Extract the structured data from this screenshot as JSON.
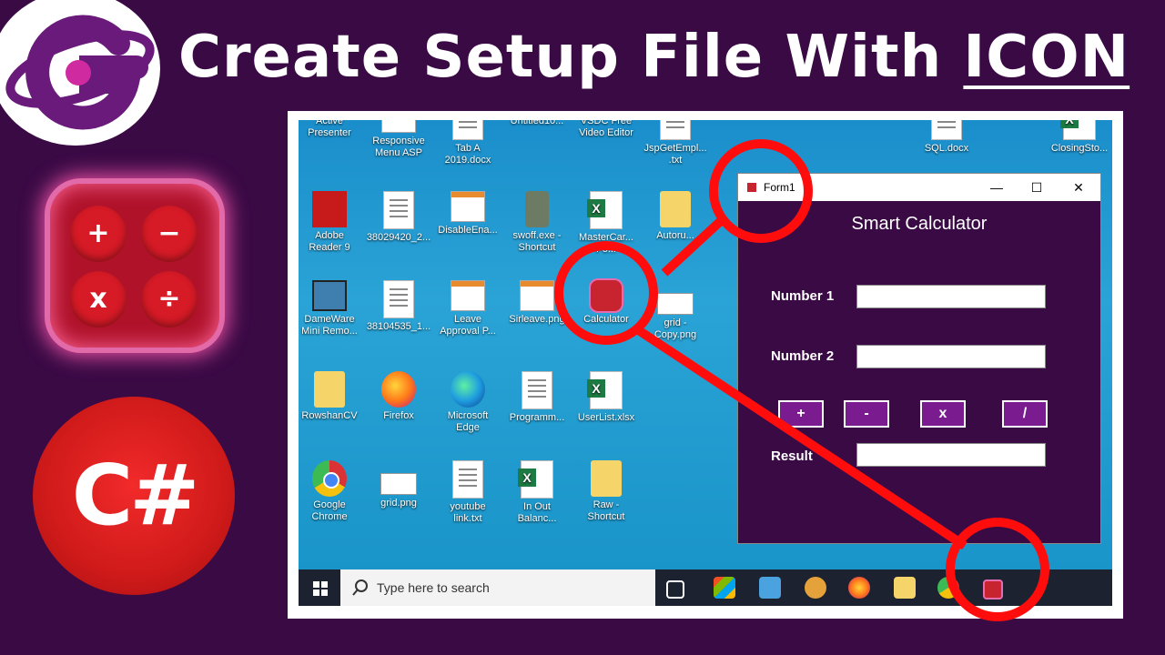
{
  "header": {
    "title_prefix": "Create Setup File With ",
    "title_highlight": "ICON"
  },
  "logo": {
    "icon": "g-logo-icon"
  },
  "calc_icon": {
    "keys": [
      "+",
      "−",
      "x",
      "÷"
    ]
  },
  "language_badge": {
    "text": "C#"
  },
  "desktop": {
    "icons": [
      {
        "label": "Active\nPresenter",
        "kind": "dark"
      },
      {
        "label": "Responsive\nMenu ASP",
        "kind": "web"
      },
      {
        "label": "Tab A\n2019.docx",
        "kind": "doc"
      },
      {
        "label": "Untitled10...",
        "kind": "dark"
      },
      {
        "label": "VSDC Free\nVideo Editor",
        "kind": "dark"
      },
      {
        "label": "JspGetEmpl...\n.txt",
        "kind": "doc"
      },
      {
        "label": "Adobe\nReader 9",
        "kind": "pdf"
      },
      {
        "label": "38029420_2...",
        "kind": "doc"
      },
      {
        "label": "DisableEna...",
        "kind": "web"
      },
      {
        "label": "swoff.exe -\nShortcut",
        "kind": "plug"
      },
      {
        "label": "MasterCar...\nFo...",
        "kind": "excel"
      },
      {
        "label": "Autoru...",
        "kind": "folder"
      },
      {
        "label": "DameWare\nMini Remo...",
        "kind": "monitor"
      },
      {
        "label": "38104535_1...",
        "kind": "doc"
      },
      {
        "label": "Leave\nApproval P...",
        "kind": "web"
      },
      {
        "label": "Sirleave.png",
        "kind": "web"
      },
      {
        "label": "Calculator",
        "kind": "calc"
      },
      {
        "label": "grid -\nCopy.png",
        "kind": "grid"
      },
      {
        "label": "RowshanCV",
        "kind": "folder"
      },
      {
        "label": "Firefox",
        "kind": "firefox"
      },
      {
        "label": "Microsoft\nEdge",
        "kind": "edge"
      },
      {
        "label": "Programm...",
        "kind": "doc"
      },
      {
        "label": "UserList.xlsx",
        "kind": "excel"
      },
      {
        "label": "Google\nChrome",
        "kind": "chrome"
      },
      {
        "label": "grid.png",
        "kind": "grid"
      },
      {
        "label": "youtube\nlink.txt",
        "kind": "doc"
      },
      {
        "label": "In Out\nBalanc...",
        "kind": "excel"
      },
      {
        "label": "Raw -\nShortcut",
        "kind": "folder"
      },
      {
        "label": "SQL.docx",
        "kind": "doc"
      },
      {
        "label": "ClosingSto...",
        "kind": "excel"
      }
    ]
  },
  "form": {
    "window_title": "Form1",
    "minimize": "—",
    "maximize": "☐",
    "close": "✕",
    "heading": "Smart Calculator",
    "number1_label": "Number 1",
    "number2_label": "Number 2",
    "result_label": "Result",
    "number1_value": "",
    "number2_value": "",
    "result_value": "",
    "ops": [
      "+",
      "-",
      "x",
      "/"
    ]
  },
  "taskbar": {
    "search_placeholder": "Type here to search"
  },
  "colors": {
    "background": "#3a0a45",
    "annotation_red": "#ff0d0d",
    "form_bg": "#3a0a44",
    "op_button": "#7a1b8f"
  }
}
